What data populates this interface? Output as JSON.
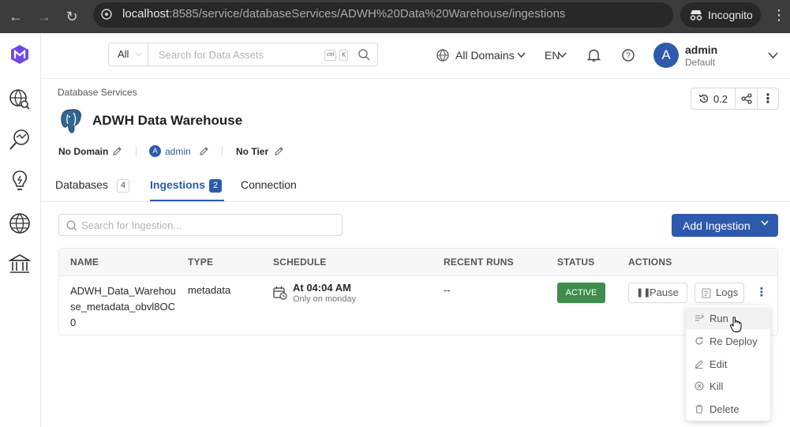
{
  "browser": {
    "url_host": "localhost",
    "url_path": ":8585/service/databaseServices/ADWH%20Data%20Warehouse/ingestions",
    "incognito_label": "Incognito"
  },
  "sidebar": {
    "items": [
      "app-logo-icon",
      "explore-icon",
      "data-insights-icon",
      "lightbulb-icon",
      "globe-icon",
      "governance-icon"
    ]
  },
  "topnav": {
    "search_scope": "All",
    "search_placeholder": "Search for Data Assets",
    "kbd_ctrl": "ctrl",
    "kbd_k": "K",
    "domains_label": "All Domains",
    "language": "EN",
    "user_initial": "A",
    "user_name": "admin",
    "user_role": "Default"
  },
  "header": {
    "breadcrumb": "Database Services",
    "title": "ADWH Data Warehouse",
    "version": "0.2",
    "domain": "No Domain",
    "owner_initial": "A",
    "owner": "admin",
    "tier": "No Tier"
  },
  "tabs": [
    {
      "label": "Databases",
      "count": "4"
    },
    {
      "label": "Ingestions",
      "count": "2"
    },
    {
      "label": "Connection"
    }
  ],
  "ingestions": {
    "search_placeholder": "Search for Ingestion...",
    "add_label": "Add Ingestion",
    "columns": [
      "NAME",
      "TYPE",
      "SCHEDULE",
      "RECENT RUNS",
      "STATUS",
      "ACTIONS"
    ],
    "row": {
      "name": "ADWH_Data_Warehouse_metadata_obvl8OC0",
      "type": "metadata",
      "schedule_time": "At 04:04 AM",
      "schedule_desc": "Only on monday",
      "recent_runs": "--",
      "status": "ACTIVE",
      "pause_label": "Pause",
      "logs_label": "Logs"
    },
    "menu": [
      "Run",
      "Re Deploy",
      "Edit",
      "Kill",
      "Delete"
    ]
  },
  "colors": {
    "accent": "#2e5aad",
    "active_status": "#3e8d4d"
  }
}
